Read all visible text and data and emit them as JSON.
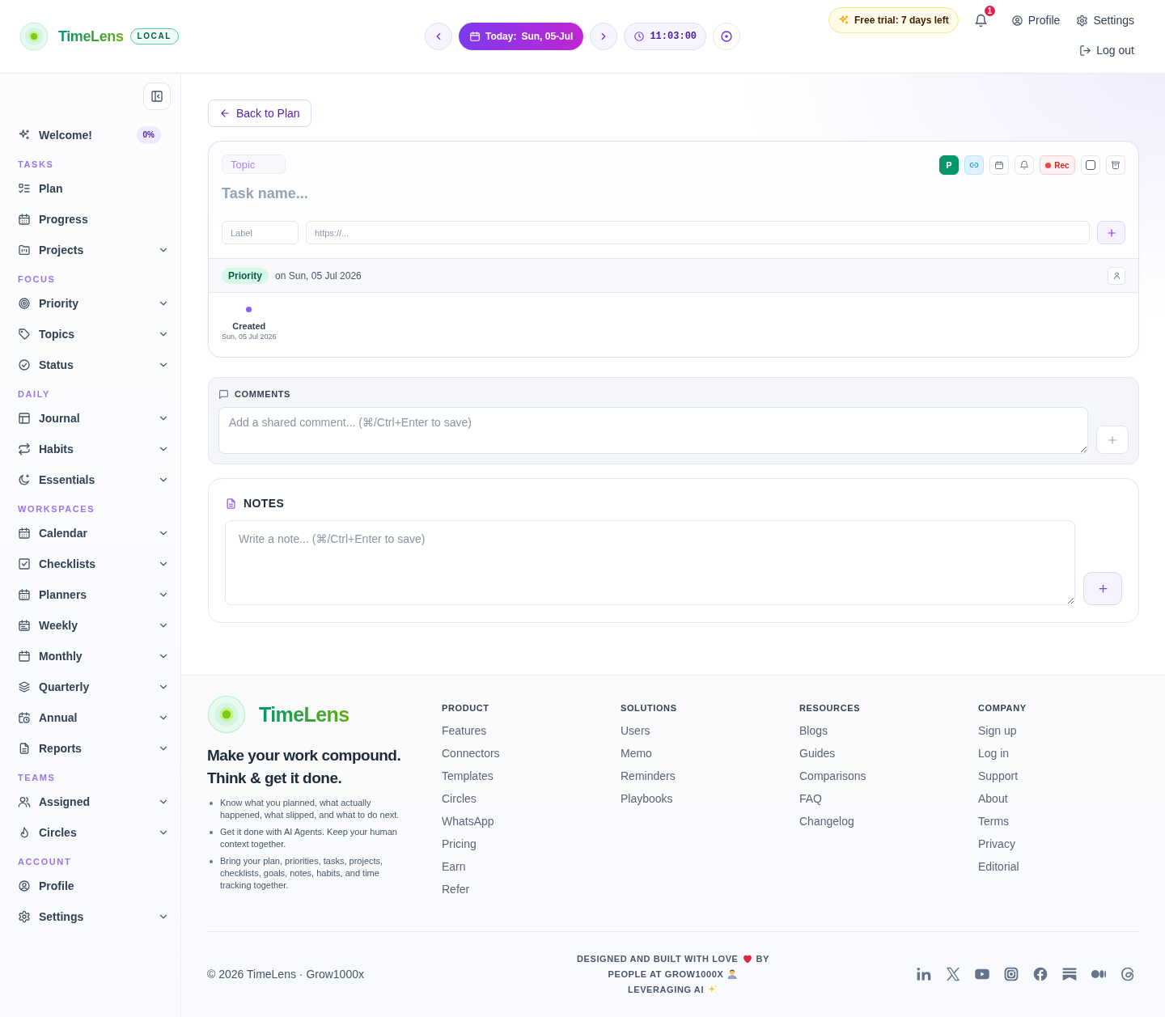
{
  "header": {
    "brand": "TimeLens",
    "badge": "LOCAL",
    "date_button": {
      "label": "Today:",
      "date": "Sun, 05-Jul"
    },
    "clock": "11:03:00",
    "trial": "Free trial: 7 days left",
    "notification_count": "1",
    "links": [
      "Profile",
      "Settings"
    ],
    "logout": "Log out"
  },
  "sidebar": {
    "welcome": {
      "label": "Welcome!",
      "progress": "0%"
    },
    "sections": [
      {
        "title": "TASKS",
        "items": [
          {
            "label": "Plan",
            "expandable": false
          },
          {
            "label": "Progress",
            "expandable": false
          },
          {
            "label": "Projects",
            "expandable": true
          }
        ]
      },
      {
        "title": "FOCUS",
        "items": [
          {
            "label": "Priority",
            "expandable": true
          },
          {
            "label": "Topics",
            "expandable": true
          },
          {
            "label": "Status",
            "expandable": true
          }
        ]
      },
      {
        "title": "DAILY",
        "items": [
          {
            "label": "Journal",
            "expandable": true
          },
          {
            "label": "Habits",
            "expandable": true
          },
          {
            "label": "Essentials",
            "expandable": true
          }
        ]
      },
      {
        "title": "WORKSPACES",
        "items": [
          {
            "label": "Calendar",
            "expandable": true
          },
          {
            "label": "Checklists",
            "expandable": true
          },
          {
            "label": "Planners",
            "expandable": true
          },
          {
            "label": "Weekly",
            "expandable": true
          },
          {
            "label": "Monthly",
            "expandable": true
          },
          {
            "label": "Quarterly",
            "expandable": true
          },
          {
            "label": "Annual",
            "expandable": true
          },
          {
            "label": "Reports",
            "expandable": true
          }
        ]
      },
      {
        "title": "TEAMS",
        "items": [
          {
            "label": "Assigned",
            "expandable": true
          },
          {
            "label": "Circles",
            "expandable": true
          }
        ]
      },
      {
        "title": "ACCOUNT",
        "items": [
          {
            "label": "Profile",
            "expandable": false
          },
          {
            "label": "Settings",
            "expandable": true
          }
        ]
      }
    ]
  },
  "main": {
    "back_button": "Back to Plan",
    "task": {
      "topic": "Topic",
      "name_placeholder": "Task name...",
      "toolbar": [
        {
          "kind": "priority",
          "label": "P"
        },
        {
          "kind": "link",
          "on": true
        },
        {
          "kind": "date",
          "on": false
        },
        {
          "kind": "reminder",
          "on": false
        },
        {
          "kind": "record",
          "label": "Rec"
        },
        {
          "kind": "complete",
          "checked": false
        },
        {
          "kind": "archive",
          "on": false
        }
      ],
      "link_form": {
        "label_placeholder": "Label",
        "url_placeholder": "https://..."
      },
      "priority": "Priority",
      "scheduled": "on Sun, 05 Jul 2026",
      "timeline": [
        {
          "event": "Created",
          "date": "Sun, 05 Jul 2026"
        }
      ]
    },
    "comments": {
      "title": "COMMENTS",
      "placeholder": "Add a shared comment... (⌘/Ctrl+Enter to save)"
    },
    "notes": {
      "title": "NOTES",
      "placeholder": "Write a note... (⌘/Ctrl+Enter to save)"
    }
  },
  "footer": {
    "brand": "TimeLens",
    "tagline": [
      "Make your work compound.",
      "Think & get it done."
    ],
    "points": [
      "Know what you planned, what actually happened, what slipped, and what to do next.",
      "Get it done with AI Agents. Keep your human context together.",
      "Bring your plan, priorities, tasks, projects, checklists, goals, notes, habits, and time tracking together."
    ],
    "columns": [
      {
        "title": "PRODUCT",
        "links": [
          "Features",
          "Connectors",
          "Templates",
          "Circles",
          "WhatsApp",
          "Pricing",
          "Earn",
          "Refer"
        ]
      },
      {
        "title": "SOLUTIONS",
        "links": [
          "Users",
          "Memo",
          "Reminders",
          "Playbooks"
        ]
      },
      {
        "title": "RESOURCES",
        "links": [
          "Blogs",
          "Guides",
          "Comparisons",
          "FAQ",
          "Changelog"
        ]
      },
      {
        "title": "COMPANY",
        "links": [
          "Sign up",
          "Log in",
          "Support",
          "About",
          "Terms",
          "Privacy",
          "Editorial"
        ]
      }
    ],
    "copyright": "© 2026 TimeLens · Grow1000x",
    "credit": [
      {
        "text": "DESIGNED AND BUILT WITH LOVE",
        "after": "BY"
      },
      {
        "text": "PEOPLE AT GROW1000X"
      },
      {
        "text": "LEVERAGING AI"
      }
    ]
  }
}
